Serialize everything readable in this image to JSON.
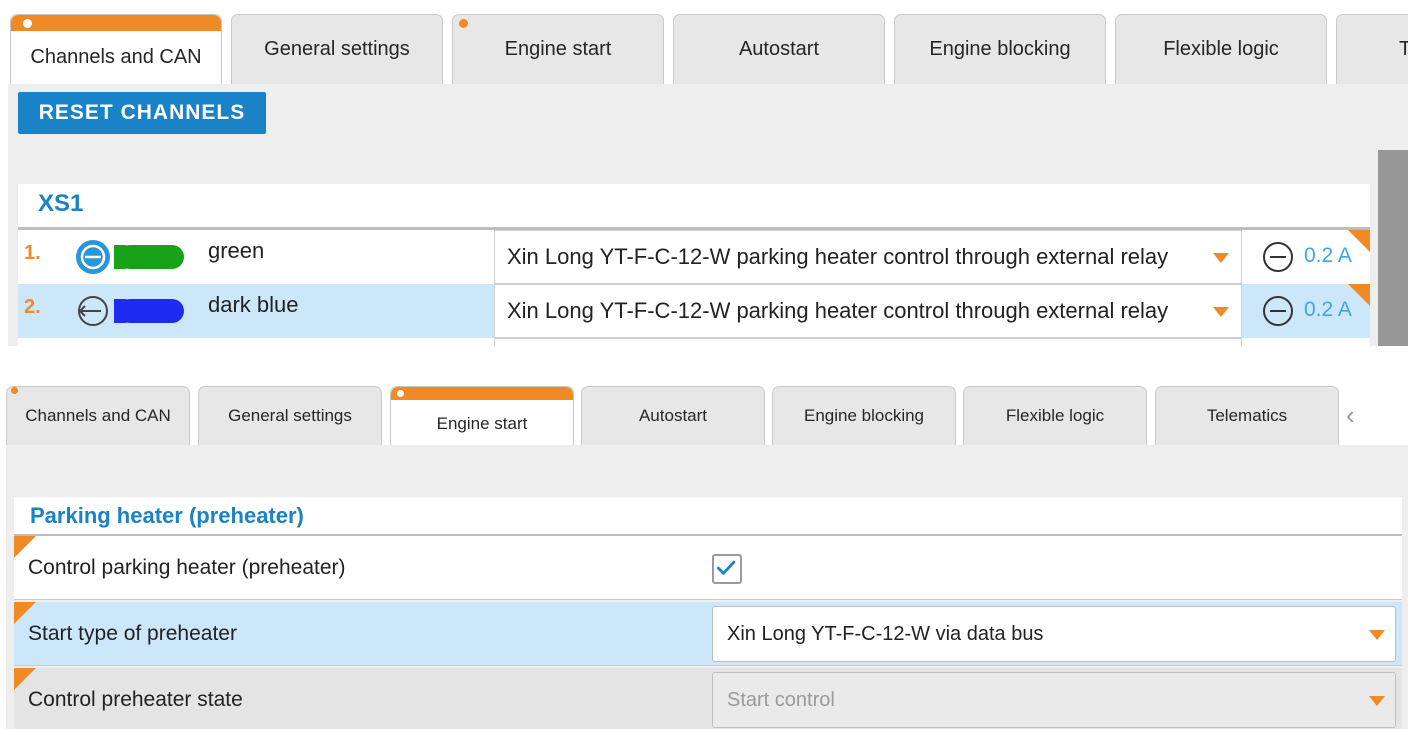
{
  "top": {
    "tabs": [
      {
        "label": "Channels and CAN"
      },
      {
        "label": "General settings"
      },
      {
        "label": "Engine start"
      },
      {
        "label": "Autostart"
      },
      {
        "label": "Engine blocking"
      },
      {
        "label": "Flexible logic"
      },
      {
        "label": "T"
      }
    ],
    "reset_label": "RESET CHANNELS",
    "section_title": "XS1",
    "channels": [
      {
        "number": "1.",
        "color_name": "green",
        "cable_color": "#17a21a",
        "function": "Xin Long YT-F-C-12-W parking heater control through external relay",
        "current": "0.2 A"
      },
      {
        "number": "2.",
        "color_name": "dark blue",
        "cable_color": "#1f2bf0",
        "function": "Xin Long YT-F-C-12-W parking heater control through external relay",
        "current": "0.2 A"
      }
    ]
  },
  "bottom": {
    "tabs": [
      {
        "label": "Channels and CAN"
      },
      {
        "label": "General settings"
      },
      {
        "label": "Engine start"
      },
      {
        "label": "Autostart"
      },
      {
        "label": "Engine blocking"
      },
      {
        "label": "Flexible logic"
      },
      {
        "label": "Telematics"
      }
    ],
    "chevron": "‹",
    "section_title": "Parking heater (preheater)",
    "rows": [
      {
        "label": "Control parking heater (preheater)",
        "checked": true
      },
      {
        "label": "Start type of preheater",
        "value": "Xin Long YT-F-C-12-W via data bus"
      },
      {
        "label": "Control preheater state",
        "value": "Start control"
      }
    ]
  },
  "colors": {
    "accent": "#1a82c6",
    "orange": "#f08a24",
    "selected_row": "#cde7fa"
  }
}
